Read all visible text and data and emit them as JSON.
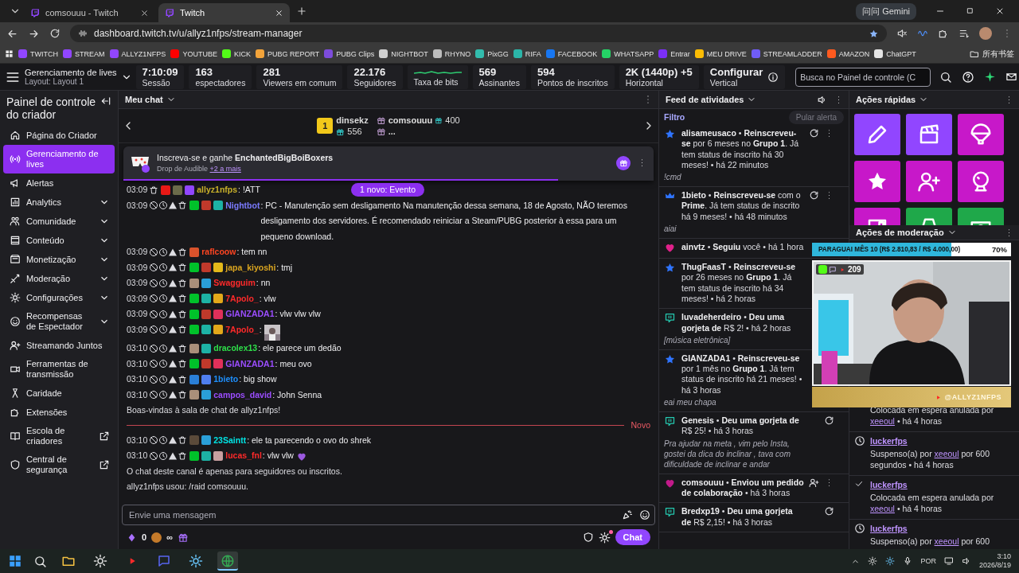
{
  "browser": {
    "tabs": [
      {
        "title": "comsouuu - Twitch",
        "selected": false
      },
      {
        "title": "Twitch",
        "selected": true
      }
    ],
    "gemini": "问问 Gemini",
    "url": "dashboard.twitch.tv/u/allyz1nfps/stream-manager",
    "bookmarks": [
      {
        "label": "TWITCH",
        "color": "#9146ff"
      },
      {
        "label": "STREAM",
        "color": "#9146ff"
      },
      {
        "label": "ALLYZ1NFPS",
        "color": "#9146ff"
      },
      {
        "label": "YOUTUBE",
        "color": "#ff0000"
      },
      {
        "label": "KICK",
        "color": "#53fc18"
      },
      {
        "label": "PUBG REPORT",
        "color": "#f2a33a"
      },
      {
        "label": "PUBG Clips",
        "color": "#7d4cdb"
      },
      {
        "label": "NIGHTBOT",
        "color": "#cfcfcf"
      },
      {
        "label": "RHYNO",
        "color": "#bdbdbd"
      },
      {
        "label": "PixGG",
        "color": "#32bcad"
      },
      {
        "label": "RIFA",
        "color": "#2bb5a8"
      },
      {
        "label": "FACEBOOK",
        "color": "#1877f2"
      },
      {
        "label": "WHATSAPP",
        "color": "#25d366"
      },
      {
        "label": "Entrar",
        "color": "#7b2ff7"
      },
      {
        "label": "MEU DRIVE",
        "color": "#fbbc04"
      },
      {
        "label": "STREAMLADDER",
        "color": "#6f5cf6"
      },
      {
        "label": "AMAZON",
        "color": "#ff5a1f"
      },
      {
        "label": "ChatGPT",
        "color": "#e5e5e5"
      }
    ],
    "all_bookmarks": "所有书签"
  },
  "header": {
    "title": "Gerenciamento de lives",
    "layout": "Layout: Layout 1",
    "stats": [
      {
        "kind": "value",
        "value": "7:10:09",
        "label": "Sessão"
      },
      {
        "kind": "value",
        "value": "163",
        "label": "espectadores"
      },
      {
        "kind": "value",
        "value": "281",
        "label": "Viewers em comum"
      },
      {
        "kind": "value",
        "value": "22.176",
        "label": "Seguidores"
      },
      {
        "kind": "graph",
        "label": "Taxa de bits"
      },
      {
        "kind": "value",
        "value": "569",
        "label": "Assinantes"
      },
      {
        "kind": "value",
        "value": "594",
        "label": "Pontos de inscritos"
      },
      {
        "kind": "value",
        "value": "2K (1440p) +5",
        "label": "Horizontal"
      },
      {
        "kind": "info",
        "value": "Configurar",
        "label": "Vertical"
      }
    ],
    "search": {
      "placeholder": "Busca no Painel de controle (C"
    }
  },
  "sidebar": {
    "title": "Painel de controle do criador",
    "items": [
      {
        "label": "Página do Criador",
        "kind": "link",
        "selected": false
      },
      {
        "label": "Gerenciamento de lives",
        "kind": "link",
        "selected": true
      },
      {
        "label": "Alertas",
        "kind": "link",
        "selected": false
      },
      {
        "label": "Analytics",
        "kind": "menu",
        "selected": false,
        "expanded": false
      },
      {
        "label": "Comunidade",
        "kind": "menu",
        "selected": false,
        "expanded": false
      },
      {
        "label": "Conteúdo",
        "kind": "menu",
        "selected": false,
        "expanded": false
      },
      {
        "label": "Monetização",
        "kind": "menu",
        "selected": false,
        "expanded": false
      },
      {
        "label": "Moderação",
        "kind": "menu",
        "selected": false,
        "expanded": false
      },
      {
        "label": "Configurações",
        "kind": "menu",
        "selected": false,
        "expanded": false
      },
      {
        "label": "Recompensas de Espectador",
        "kind": "menu",
        "selected": false,
        "expanded": false
      },
      {
        "label": "Streamando Juntos",
        "kind": "link",
        "selected": false
      },
      {
        "label": "Ferramentas de transmissão",
        "kind": "link",
        "selected": false
      },
      {
        "label": "Caridade",
        "kind": "link",
        "selected": false
      },
      {
        "label": "Extensões",
        "kind": "link",
        "selected": false
      },
      {
        "label": "Escola de criadores",
        "kind": "external",
        "selected": false
      },
      {
        "label": "Central de segurança",
        "kind": "external",
        "selected": false
      }
    ]
  },
  "chat": {
    "title": "Meu chat",
    "top_gifter": {
      "name": "dinsekz",
      "rank": "1",
      "count": "556"
    },
    "gifters": [
      {
        "name": "comsouuu",
        "count": "400"
      },
      {
        "name": "..."
      }
    ],
    "pinned": {
      "text": "Inscreva-se e ganhe **EnchantedBigBoiBoxers**",
      "subtitle": "Drop de Audible",
      "more": "+2 a mais",
      "level": 0.82
    },
    "new_events": "1 novo: Evento",
    "messages": [
      {
        "kind": "message",
        "time": "03:09",
        "mod_tools": false,
        "badges": [
          {
            "color": "#e91916"
          },
          {
            "color": "#6b6b4a"
          },
          {
            "color": "#9146ff"
          }
        ],
        "user": "allyz1nfps",
        "color": "#c9b12a",
        "text": ": !ATT"
      },
      {
        "kind": "message",
        "time": "03:09",
        "mod_tools": true,
        "badges": [
          {
            "color": "#00c22a"
          },
          {
            "color": "#c0392b"
          },
          {
            "color": "#1db2a5"
          }
        ],
        "user": "Nightbot",
        "color": "#7b7bff",
        "text": ": PC - Manutenção sem desligamento Na manutenção dessa semana, 18 de Agosto, NÃO teremos desligamento dos servidores. É recomendado reiniciar a Steam/PUBG posterior à essa para um pequeno download."
      },
      {
        "kind": "message",
        "time": "03:09",
        "mod_tools": true,
        "badges": [
          {
            "color": "#d9532c"
          }
        ],
        "user": "raflcoow",
        "color": "#ff4522",
        "text": ": tem nn"
      },
      {
        "kind": "message",
        "time": "03:09",
        "mod_tools": true,
        "badges": [
          {
            "color": "#00c22a"
          },
          {
            "color": "#c0392b"
          },
          {
            "color": "#e3b81a"
          }
        ],
        "user": "japa_kiyoshi",
        "color": "#daa520",
        "text": ": tmj"
      },
      {
        "kind": "message",
        "time": "03:09",
        "mod_tools": true,
        "badges": [
          {
            "color": "#a98f7a"
          },
          {
            "color": "#2a9fd8"
          }
        ],
        "user": "Swagguim",
        "color": "#ff2a2a",
        "text": ": nn"
      },
      {
        "kind": "message",
        "time": "03:09",
        "mod_tools": true,
        "badges": [
          {
            "color": "#00c22a"
          },
          {
            "color": "#1db2a5"
          },
          {
            "color": "#e3a81a"
          }
        ],
        "user": "7Apolo_",
        "color": "#ff2a2a",
        "text": ": vlw"
      },
      {
        "kind": "message",
        "time": "03:09",
        "mod_tools": true,
        "badges": [
          {
            "color": "#00c22a"
          },
          {
            "color": "#c0392b"
          },
          {
            "color": "#e0305a"
          }
        ],
        "user": "GIANZADA1",
        "color": "#9b4dff",
        "text": ": vlw vlw vlw"
      },
      {
        "kind": "message",
        "time": "03:09",
        "mod_tools": true,
        "badges": [
          {
            "color": "#00c22a"
          },
          {
            "color": "#1db2a5"
          },
          {
            "color": "#e3a81a"
          }
        ],
        "user": "7Apolo_",
        "color": "#ff2a2a",
        "text": ":",
        "emote": {
          "kind": "picture"
        }
      },
      {
        "kind": "message",
        "time": "03:10",
        "mod_tools": true,
        "badges": [
          {
            "color": "#a98f7a"
          },
          {
            "color": "#1db2a5"
          }
        ],
        "user": "dracolex13",
        "color": "#2ee04a",
        "text": ": ele parece um dedão"
      },
      {
        "kind": "message",
        "time": "03:10",
        "mod_tools": true,
        "badges": [
          {
            "color": "#00c22a"
          },
          {
            "color": "#c0392b"
          },
          {
            "color": "#e0305a"
          }
        ],
        "user": "GIANZADA1",
        "color": "#9b4dff",
        "text": ": meu ovo"
      },
      {
        "kind": "message",
        "time": "03:10",
        "mod_tools": true,
        "badges": [
          {
            "color": "#2a7fd8"
          },
          {
            "color": "#4f7ff0"
          }
        ],
        "user": "1bieto",
        "color": "#1e90ff",
        "text": ": big show"
      },
      {
        "kind": "message",
        "time": "03:10",
        "mod_tools": true,
        "badges": [
          {
            "color": "#a98f7a"
          },
          {
            "color": "#2a9fd8"
          }
        ],
        "user": "campos_david",
        "color": "#9b4dff",
        "text": ": John Senna"
      },
      {
        "kind": "notice",
        "text": "Boas-vindas à sala de chat de allyz1nfps!"
      },
      {
        "kind": "divider",
        "text": "Novo"
      },
      {
        "kind": "message",
        "time": "03:10",
        "mod_tools": true,
        "badges": [
          {
            "color": "#5a4a3a"
          },
          {
            "color": "#2a9fd8"
          }
        ],
        "user": "23Saintt",
        "color": "#00e5e5",
        "text": ": ele ta parecendo o ovo do shrek"
      },
      {
        "kind": "message",
        "time": "03:10",
        "mod_tools": true,
        "badges": [
          {
            "color": "#00c22a"
          },
          {
            "color": "#1db2a5"
          },
          {
            "color": "#c8a0a0"
          }
        ],
        "user": "lucas_fnl",
        "color": "#ff2a2a",
        "text": ": vlw vlw",
        "emote": {
          "kind": "icon"
        }
      },
      {
        "kind": "notice",
        "text": "O chat deste canal é apenas para seguidores ou inscritos."
      },
      {
        "kind": "notice",
        "text": "allyz1nfps usou: /raid comsouuu."
      }
    ],
    "composer": {
      "placeholder": "Envie uma mensagem",
      "bits": "0",
      "points": "∞",
      "send": "Chat"
    }
  },
  "feed": {
    "title": "Feed de atividades",
    "filter": "Filtro",
    "skip": {
      "label": "Pular alerta",
      "disabled": true
    },
    "items": [
      {
        "kind": "resub",
        "text": "**alisameusaco** • **Reinscreveu-se** por 6 meses no **Grupo 1**. Já tem status de inscrito há 30 meses! • há 22 minutos",
        "message": "!cmd",
        "replay": true,
        "more": true
      },
      {
        "kind": "prime",
        "text": "**1bieto** • **Reinscreveu-se** com o **Prime**. Já tem status de inscrito há 9 meses! • há 48 minutos",
        "message": "aiai",
        "replay": true,
        "more": true
      },
      {
        "kind": "follow",
        "text": "**ainvtz** • **Seguiu** você • há 1 hora"
      },
      {
        "kind": "resub",
        "text": "**ThugFaasT** • **Reinscreveu-se** por 26 meses no **Grupo 1**. Já tem status de inscrito há 34 meses! • há 2 horas"
      },
      {
        "kind": "tip",
        "text": "**luvadeherdeiro** • **Deu uma gorjeta de** R$ 2! • há 2 horas",
        "message": "[música eletrônica]"
      },
      {
        "kind": "resub",
        "text": "**GIANZADA1** • **Reinscreveu-se** por 1 mês no **Grupo 1**. Já tem status de inscrito há 21 meses! • há 3 horas",
        "message": "eai meu chapa"
      },
      {
        "kind": "tip",
        "text": "**Genesis** • **Deu uma gorjeta de** R$ 25! • há 3 horas",
        "message": "Pra ajudar na meta , vim pelo Insta, gostei da dica do inclinar , tava com dificuldade de inclinar e andar",
        "replay": true
      },
      {
        "kind": "collab",
        "text": "**comsouuu** • **Enviou um pedido de colaboração** • há 3 horas",
        "add_user": true,
        "more": true
      },
      {
        "kind": "tip",
        "text": "**Bredxp19** • **Deu uma gorjeta de** R$ 2,15! • há 3 horas",
        "replay": true
      }
    ]
  },
  "quick_actions": {
    "title": "Ações rápidas",
    "tiles": [
      {
        "color": "#9146ff"
      },
      {
        "color": "#9146ff"
      },
      {
        "color": "#c718c9"
      },
      {
        "color": "#c718c9"
      },
      {
        "color": "#c718c9"
      },
      {
        "color": "#c718c9"
      },
      {
        "color": "#c718c9"
      },
      {
        "color": "#1fa84a"
      },
      {
        "color": "#1fa84a"
      }
    ]
  },
  "moderation": {
    "title": "Ações de moderação",
    "items": [
      {
        "kind": "hidden",
        "action": "Colocada em espera anulada por",
        "moderator": "xeeoul",
        "detail": "• há 4 horas"
      },
      {
        "kind": "timeout",
        "user": "luckerfps",
        "action": "Suspenso(a) por",
        "moderator": "xeeoul",
        "detail": "por 600 segundos • há 4 horas"
      },
      {
        "kind": "approve",
        "user": "luckerfps",
        "action": "Colocada em espera anulada por",
        "moderator": "xeeoul",
        "detail": "• há 4 horas"
      },
      {
        "kind": "timeout",
        "user": "luckerfps",
        "action": "Suspenso(a) por",
        "moderator": "xeeoul",
        "detail": "por 600"
      }
    ]
  },
  "overlay": {
    "goal": {
      "text": "PARAGUAI MÊS 10 (R$ 2.810,83 / R$ 4.000,00)",
      "percent": "70%",
      "level": 0.7
    },
    "viewers": "209",
    "handle": "@ALLYZ1NFPS"
  },
  "taskbar": {
    "apps": [
      {
        "selected": false
      },
      {
        "selected": false
      },
      {
        "selected": false
      },
      {
        "selected": false
      },
      {
        "selected": false
      },
      {
        "selected": true
      }
    ],
    "language": "POR",
    "time": "3:10",
    "date": "2026/8/19"
  }
}
